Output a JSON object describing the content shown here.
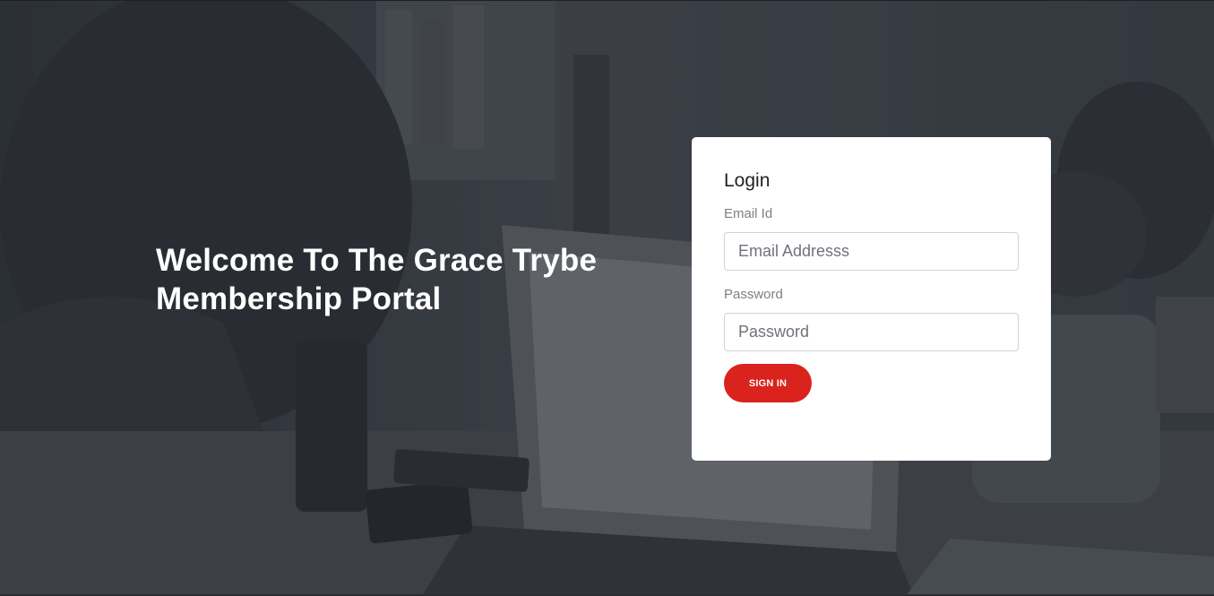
{
  "hero": {
    "line1": "Welcome To The Grace Trybe",
    "line2": "Membership Portal"
  },
  "login": {
    "title": "Login",
    "email_label": "Email Id",
    "email_placeholder": "Email Addresss",
    "email_value": "",
    "password_label": "Password",
    "password_placeholder": "Password",
    "password_value": "",
    "submit_label": "SIGN IN"
  },
  "colors": {
    "accent": "#d9231c",
    "overlay": "#3a3e45",
    "card": "#ffffff"
  }
}
